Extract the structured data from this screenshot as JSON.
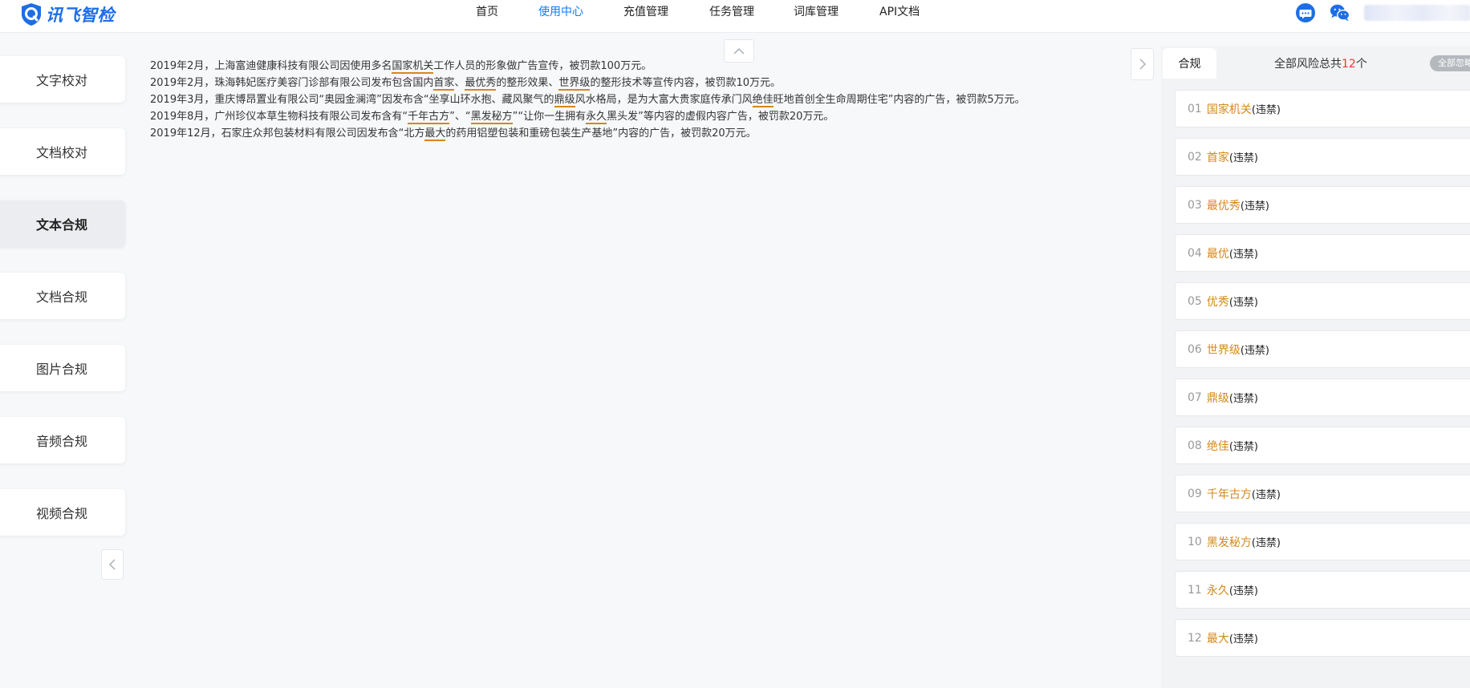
{
  "header": {
    "logo_text": "讯飞智检",
    "nav": [
      {
        "label": "首页",
        "active": false
      },
      {
        "label": "使用中心",
        "active": true
      },
      {
        "label": "充值管理",
        "active": false
      },
      {
        "label": "任务管理",
        "active": false
      },
      {
        "label": "词库管理",
        "active": false
      },
      {
        "label": "API文档",
        "active": false
      }
    ],
    "icons": [
      "chat-bubble-icon",
      "wechat-icon"
    ],
    "accent_color": "#1677ff"
  },
  "sidebar": {
    "items": [
      {
        "label": "文字校对",
        "active": false
      },
      {
        "label": "文档校对",
        "active": false
      },
      {
        "label": "文本合规",
        "active": true
      },
      {
        "label": "文档合规",
        "active": false
      },
      {
        "label": "图片合规",
        "active": false
      },
      {
        "label": "音频合规",
        "active": false
      },
      {
        "label": "视频合规",
        "active": false
      }
    ]
  },
  "content": {
    "highlight_color": "#d4881c",
    "lines": [
      [
        {
          "t": "2019年2月，上海富迪健康科技有限公司因使用多名"
        },
        {
          "t": "国家机关",
          "kw": true
        },
        {
          "t": "工作人员的形象做广告宣传，被罚款100万元。"
        }
      ],
      [
        {
          "t": "2019年2月，珠海韩妃医疗美容门诊部有限公司发布包含国内"
        },
        {
          "t": "首家",
          "kw": true
        },
        {
          "t": "、"
        },
        {
          "t": "最优秀",
          "kw": true
        },
        {
          "t": "的整形效果、"
        },
        {
          "t": "世界级",
          "kw": true
        },
        {
          "t": "的整形技术等宣传内容，被罚款10万元。"
        }
      ],
      [
        {
          "t": "2019年3月，重庆博昂置业有限公司“奥园金澜湾”因发布含“坐享山环水抱、藏风聚气的"
        },
        {
          "t": "鼎级",
          "kw": true
        },
        {
          "t": "风水格局，是为大富大贵家庭传承门风"
        },
        {
          "t": "绝佳",
          "kw": true
        },
        {
          "t": "旺地首创全生命周期住宅”内容的广告，被罚款5万元。"
        }
      ],
      [
        {
          "t": "2019年8月，广州珍仪本草生物科技有限公司发布含有“"
        },
        {
          "t": "千年古方",
          "kw": true
        },
        {
          "t": "”、“"
        },
        {
          "t": "黑发秘方",
          "kw": true
        },
        {
          "t": "”“让你一生拥有"
        },
        {
          "t": "永久",
          "kw": true
        },
        {
          "t": "黑头发”等内容的虚假内容广告，被罚款20万元。"
        }
      ],
      [
        {
          "t": "2019年12月，石家庄众邦包装材料有限公司因发布含“北方"
        },
        {
          "t": "最大",
          "kw": true
        },
        {
          "t": "的药用铝塑包装和重磅包装生产基地”内容的广告，被罚款20万元。"
        }
      ]
    ]
  },
  "right_panel": {
    "tab_label": "合规",
    "summary_prefix": "全部风险总共",
    "summary_count": "12",
    "summary_suffix": "个",
    "ignore_all_label": "全部忽略",
    "items": [
      {
        "num": "01",
        "word": "国家机关",
        "tag": "(违禁)"
      },
      {
        "num": "02",
        "word": "首家",
        "tag": "(违禁)"
      },
      {
        "num": "03",
        "word": "最优秀",
        "tag": "(违禁)"
      },
      {
        "num": "04",
        "word": "最优",
        "tag": "(违禁)"
      },
      {
        "num": "05",
        "word": "优秀",
        "tag": "(违禁)"
      },
      {
        "num": "06",
        "word": "世界级",
        "tag": "(违禁)"
      },
      {
        "num": "07",
        "word": "鼎级",
        "tag": "(违禁)"
      },
      {
        "num": "08",
        "word": "绝佳",
        "tag": "(违禁)"
      },
      {
        "num": "09",
        "word": "千年古方",
        "tag": "(违禁)"
      },
      {
        "num": "10",
        "word": "黑发秘方",
        "tag": "(违禁)"
      },
      {
        "num": "11",
        "word": "永久",
        "tag": "(违禁)"
      },
      {
        "num": "12",
        "word": "最大",
        "tag": "(违禁)"
      }
    ]
  }
}
